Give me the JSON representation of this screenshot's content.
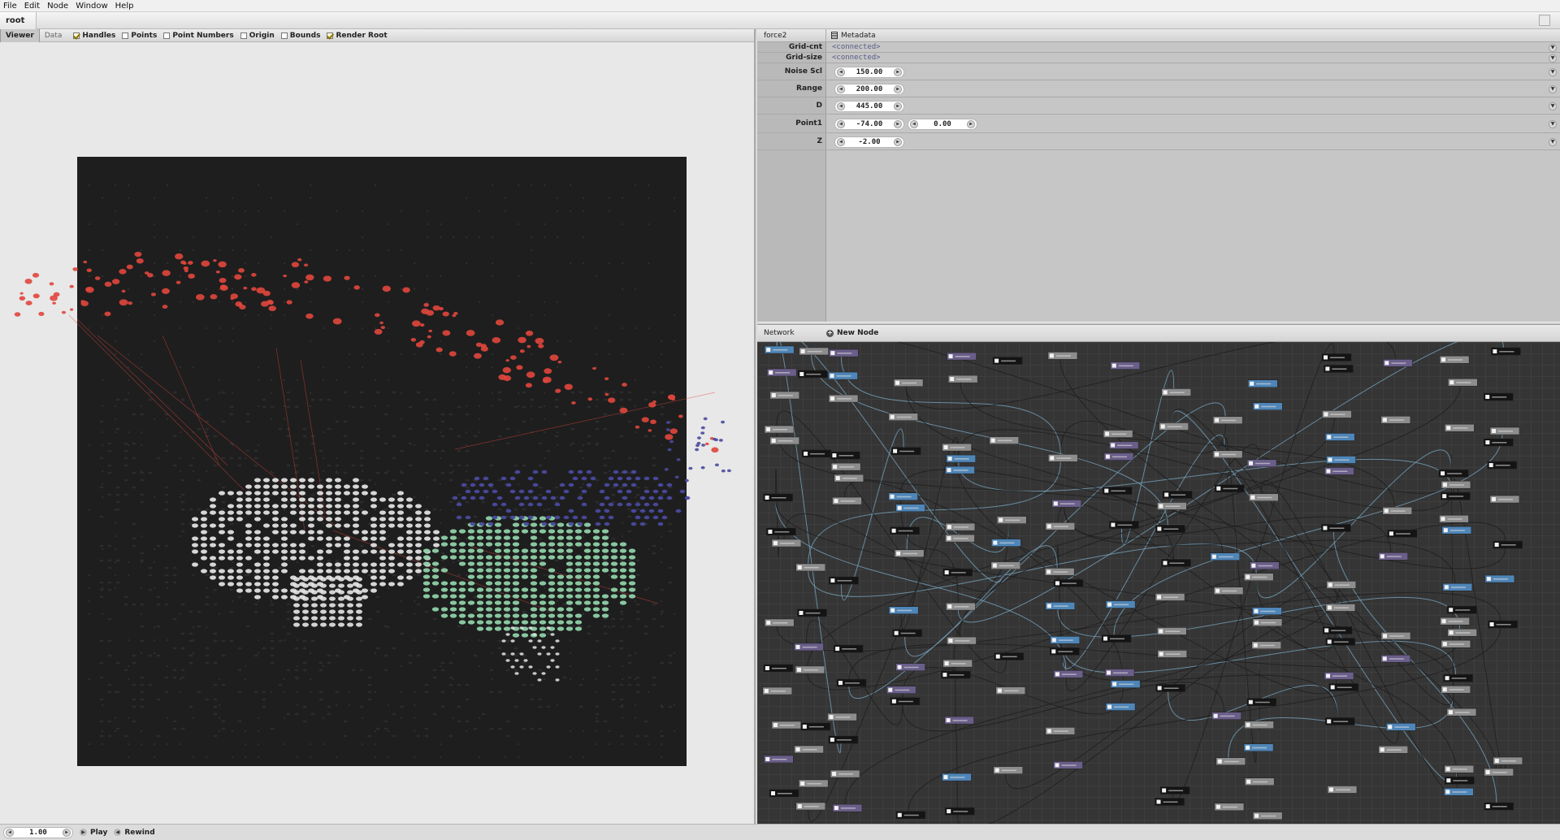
{
  "menu": [
    "File",
    "Edit",
    "Node",
    "Window",
    "Help"
  ],
  "breadcrumb": "root",
  "viewer": {
    "tabs": [
      {
        "label": "Viewer",
        "active": true
      },
      {
        "label": "Data",
        "active": false
      }
    ],
    "toggles": [
      {
        "label": "Handles",
        "checked": true
      },
      {
        "label": "Points",
        "checked": false
      },
      {
        "label": "Point Numbers",
        "checked": false
      },
      {
        "label": "Origin",
        "checked": false
      },
      {
        "label": "Bounds",
        "checked": false
      },
      {
        "label": "Render Root",
        "checked": true
      }
    ]
  },
  "params": {
    "node_name": "force2",
    "metadata_label": "Metadata",
    "rows": [
      {
        "label": "Grid-cnt",
        "kind": "connected",
        "value": "<connected>"
      },
      {
        "label": "Grid-size",
        "kind": "connected",
        "value": "<connected>"
      },
      {
        "label": "Noise Scl",
        "kind": "number",
        "value": "150.00"
      },
      {
        "label": "Range",
        "kind": "number",
        "value": "200.00"
      },
      {
        "label": "D",
        "kind": "number",
        "value": "445.00"
      },
      {
        "label": "Point1",
        "kind": "point",
        "value": "-74.00",
        "value2": "0.00"
      },
      {
        "label": "Z",
        "kind": "number",
        "value": "-2.00"
      }
    ]
  },
  "network": {
    "title": "Network",
    "new_node_label": "New Node"
  },
  "playback": {
    "frame": "1.00",
    "play_label": "Play",
    "rewind_label": "Rewind"
  },
  "colors": {
    "red": "#e0463c",
    "white": "#e6e6e6",
    "green": "#8ed0a8",
    "blue": "#4a4aa0",
    "canvas": "#1e1e1e",
    "node_default": "#8d8d8d",
    "node_blue": "#4f86b8",
    "node_purple": "#6a5e8a",
    "node_black": "#141414"
  }
}
